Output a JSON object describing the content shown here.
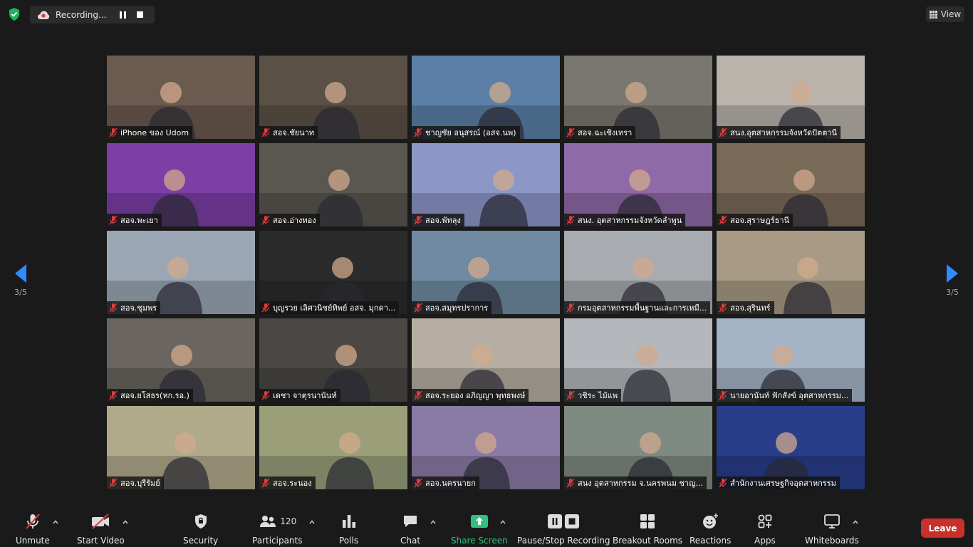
{
  "topbar": {
    "recording_label": "Recording...",
    "view_label": "View"
  },
  "navigation": {
    "page_left": "3/5",
    "page_right": "3/5"
  },
  "participants": [
    {
      "name": "iPhone ของ Udom",
      "bg": "#6b5a4e"
    },
    {
      "name": "สอจ.ชัยนาท",
      "bg": "#5b5046"
    },
    {
      "name": "ชาญชัย อนุสรณ์ (อสจ.นพ)",
      "bg": "#5b7fa6"
    },
    {
      "name": "สอจ.ฉะเชิงเทรา",
      "bg": "#7a7770"
    },
    {
      "name": "สนง.อุตสาหกรรมจังหวัดปัตตานี",
      "bg": "#b9b3ab"
    },
    {
      "name": "สอจ.พะเยา",
      "bg": "#7b3fa5"
    },
    {
      "name": "สอจ.อ่างทอง",
      "bg": "#5a5650"
    },
    {
      "name": "สอจ.พัทลุง",
      "bg": "#8a97c7"
    },
    {
      "name": "สนง. อุตสาหกรรมจังหวัดลำพูน",
      "bg": "#8e6aa8"
    },
    {
      "name": "สอจ.สุราษฎร์ธานี",
      "bg": "#7a6a58"
    },
    {
      "name": "สอจ.ชุมพร",
      "bg": "#9aa6b3"
    },
    {
      "name": "บุญรวย  เลิศวนิชย์ทิพย์ อสจ. มุกดา...",
      "bg": "#2b2b2b"
    },
    {
      "name": "สอจ.สมุทรปราการ",
      "bg": "#6f8aa1"
    },
    {
      "name": "กรมอุตสาหกรรมพื้นฐานและการเหมื...",
      "bg": "#a8acb0"
    },
    {
      "name": "สอจ.สุรินทร์",
      "bg": "#a89a84"
    },
    {
      "name": "สอจ.ยโสธร(หก.รอ.)",
      "bg": "#6a6560"
    },
    {
      "name": "เดชา จาตุรนานันท์",
      "bg": "#4a4744"
    },
    {
      "name": "สอจ.ระยอง อภิญญา พุทธพงษ์",
      "bg": "#b6aea2"
    },
    {
      "name": "วชิระ ไม้แพ",
      "bg": "#b4b7bb"
    },
    {
      "name": "นายอานันท์  ฟักสังข์  อุตสาหกรรม...",
      "bg": "#a4b4c6"
    },
    {
      "name": "สอจ.บุรีรัมย์",
      "bg": "#b0aa8a"
    },
    {
      "name": "สอจ.ระนอง",
      "bg": "#9a9f7a"
    },
    {
      "name": "สอจ.นครนายก",
      "bg": "#8a7aa6"
    },
    {
      "name": "สนง อุตสาหกรรม จ.นครพนม ชาญ...",
      "bg": "#7e8a82"
    },
    {
      "name": "สำนักงานเศรษฐกิจอุตสาหกรรม",
      "bg": "#283e8a"
    }
  ],
  "toolbar": {
    "unmute": "Unmute",
    "start_video": "Start Video",
    "security": "Security",
    "participants": "Participants",
    "participant_count": "120",
    "polls": "Polls",
    "chat": "Chat",
    "share_screen": "Share Screen",
    "pause_stop_recording": "Pause/Stop Recording",
    "breakout_rooms": "Breakout Rooms",
    "reactions": "Reactions",
    "apps": "Apps",
    "whiteboards": "Whiteboards",
    "leave": "Leave"
  },
  "colors": {
    "accent_blue": "#2d8cff",
    "share_green": "#2ec27e",
    "leave_red": "#c9302c",
    "mic_off_red": "#e23b3b"
  }
}
